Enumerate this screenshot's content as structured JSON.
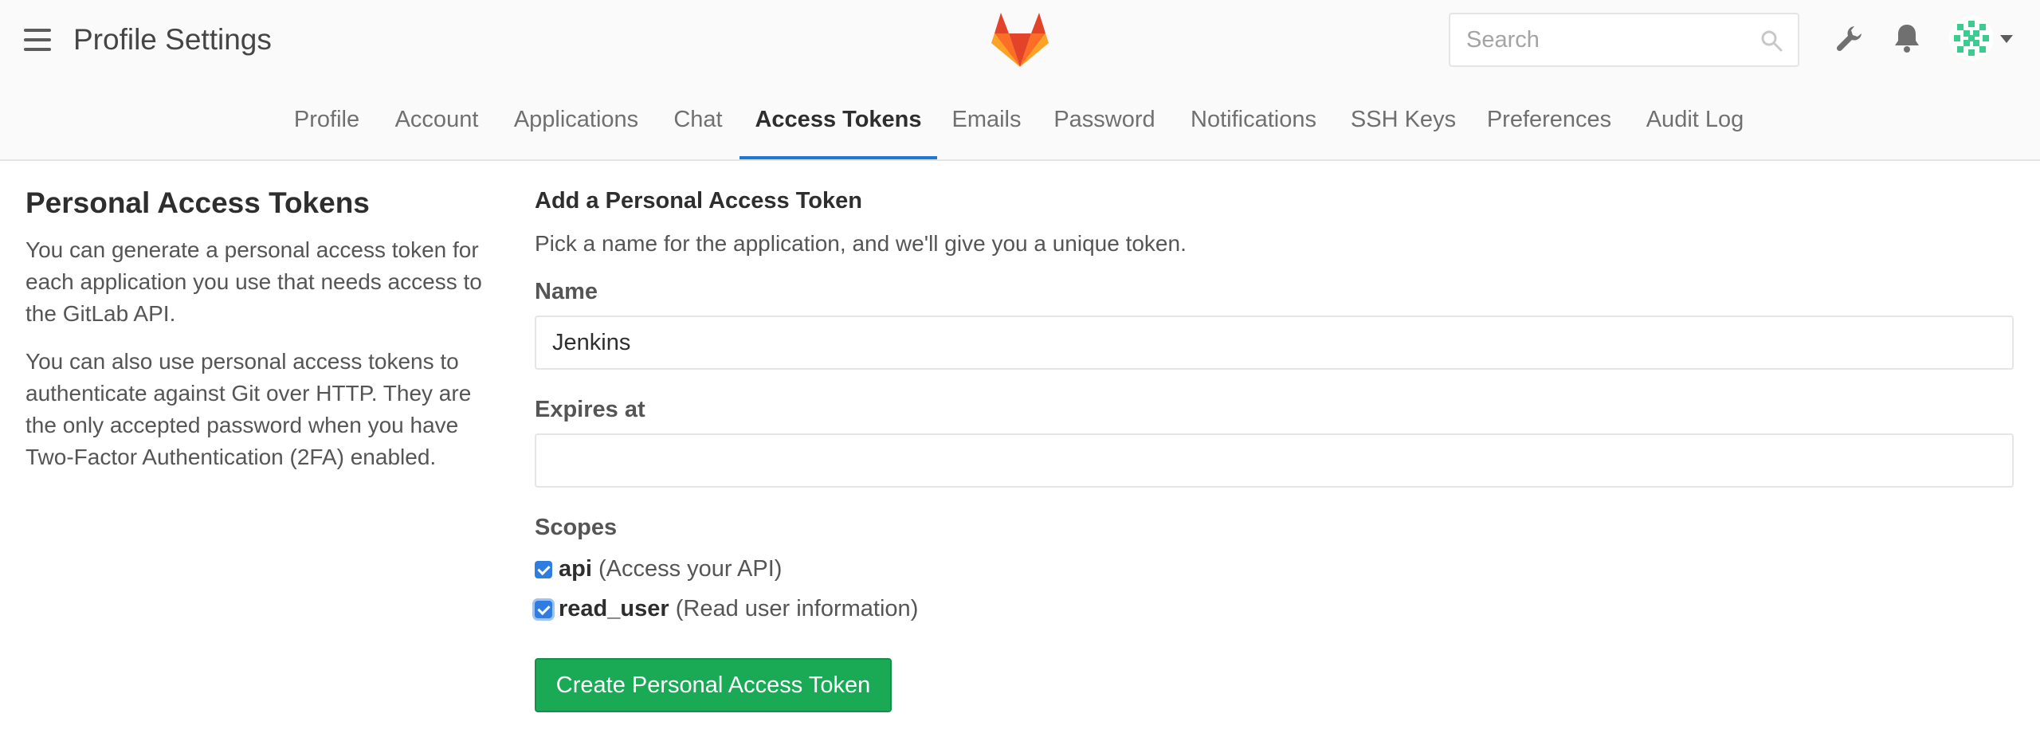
{
  "header": {
    "title": "Profile Settings",
    "search_placeholder": "Search",
    "icons": [
      "hamburger-icon",
      "gitlab-logo",
      "search-icon",
      "wrench-icon",
      "bell-icon",
      "avatar",
      "caret-down-icon"
    ]
  },
  "tabs": [
    {
      "label": "Profile"
    },
    {
      "label": "Account"
    },
    {
      "label": "Applications"
    },
    {
      "label": "Chat"
    },
    {
      "label": "Access Tokens",
      "active": true
    },
    {
      "label": "Emails"
    },
    {
      "label": "Password"
    },
    {
      "label": "Notifications"
    },
    {
      "label": "SSH Keys"
    },
    {
      "label": "Preferences"
    },
    {
      "label": "Audit Log"
    }
  ],
  "sidebar": {
    "heading": "Personal Access Tokens",
    "paragraphs": [
      "You can generate a personal access token for each application you use that needs access to the GitLab API.",
      "You can also use personal access tokens to authenticate against Git over HTTP. They are the only accepted password when you have Two-Factor Authentication (2FA) enabled."
    ]
  },
  "form": {
    "heading": "Add a Personal Access Token",
    "subtitle": "Pick a name for the application, and we'll give you a unique token.",
    "name_label": "Name",
    "name_value": "Jenkins",
    "expires_label": "Expires at",
    "expires_value": "",
    "scopes_label": "Scopes",
    "scopes": [
      {
        "name": "api",
        "description": "(Access your API)",
        "checked": true
      },
      {
        "name": "read_user",
        "description": "(Read user information)",
        "checked": true
      }
    ],
    "submit_label": "Create Personal Access Token"
  },
  "colors": {
    "accent": "#1f78d1",
    "checkbox": "#2f7de1",
    "submit": "#1aaa55",
    "avatar": "#3ecb8f"
  }
}
